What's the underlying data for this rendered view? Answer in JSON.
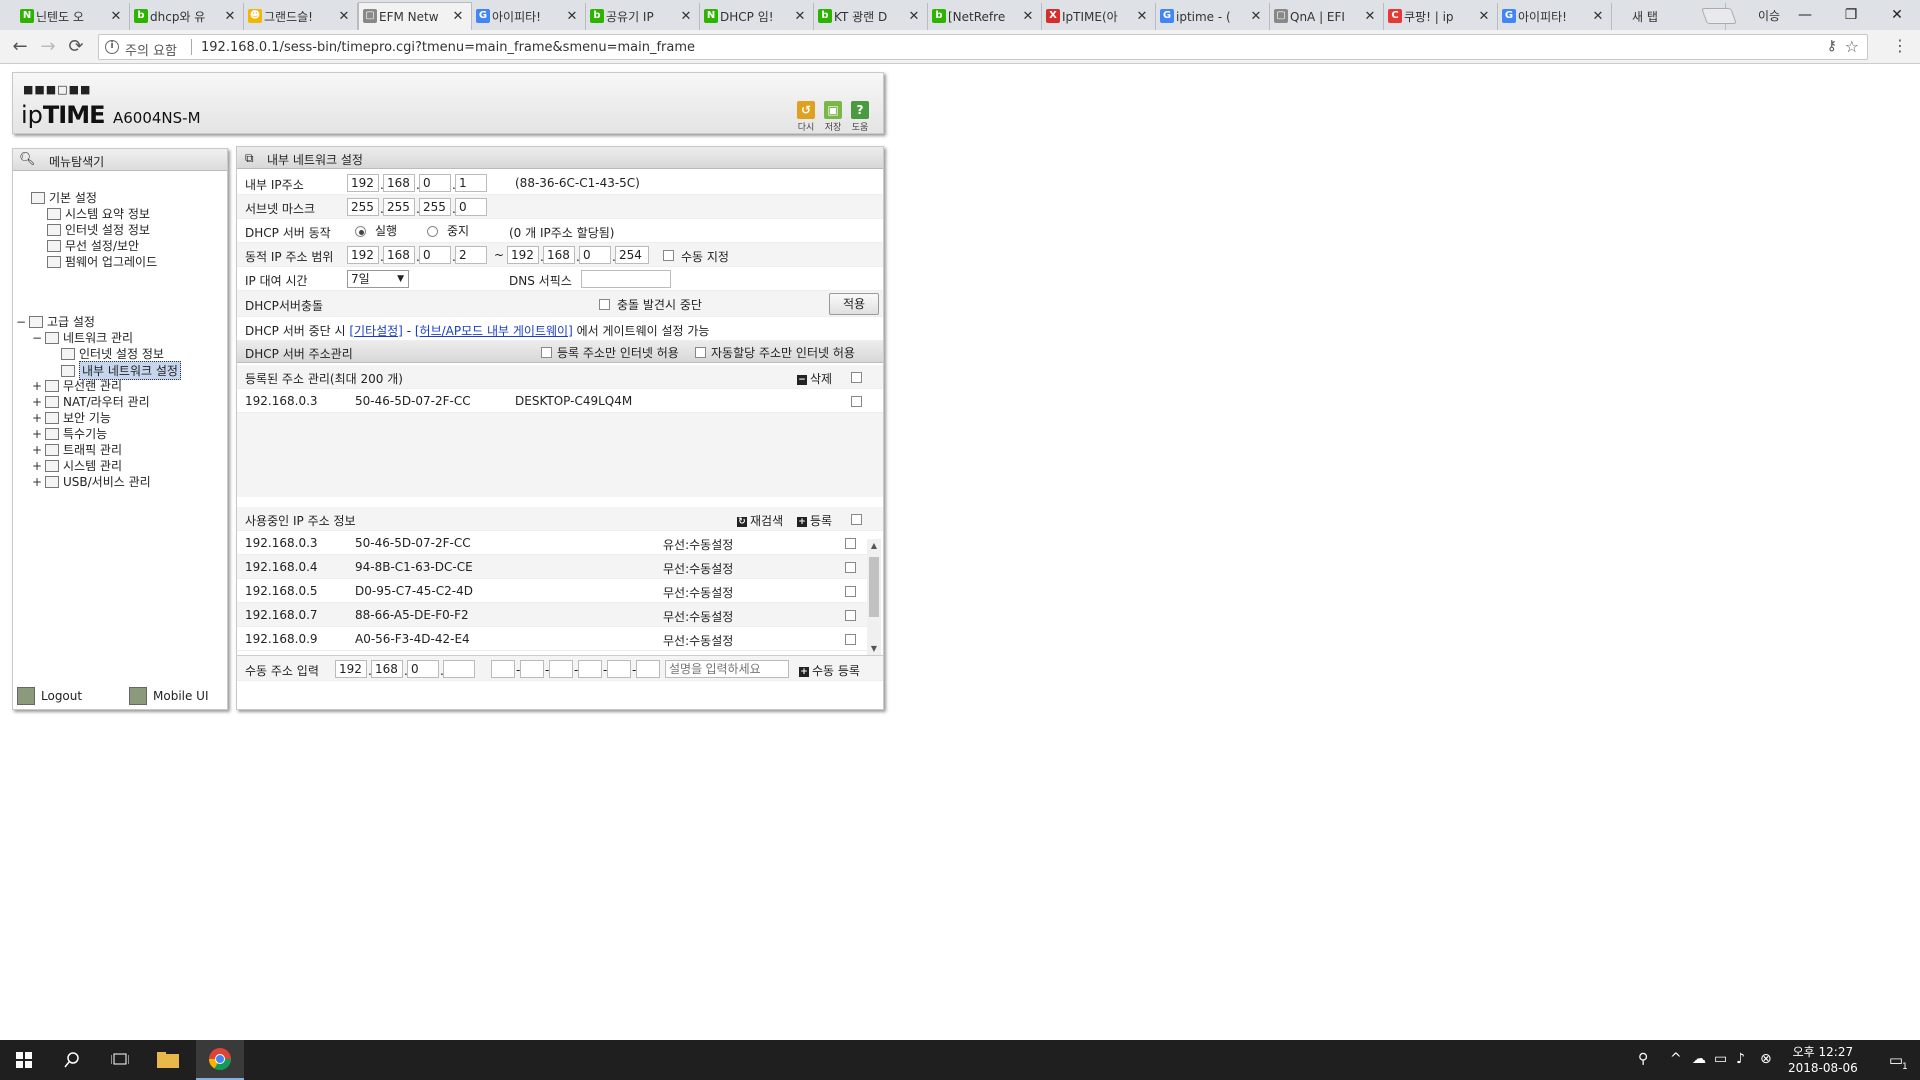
{
  "browser": {
    "tabs": [
      {
        "label": "닌텐도 오",
        "favicon": "N",
        "color": "#2db400"
      },
      {
        "label": "dhcp와 유",
        "favicon": "b",
        "color": "#2db400"
      },
      {
        "label": "그랜드슬!",
        "favicon": "☻",
        "color": "#f2b705"
      },
      {
        "label": "EFM Netw",
        "favicon": "▢",
        "color": "#888888"
      },
      {
        "label": "아이피타!",
        "favicon": "G",
        "color": "#4285f4"
      },
      {
        "label": "공유기 IP",
        "favicon": "b",
        "color": "#2db400"
      },
      {
        "label": "DHCP 임!",
        "favicon": "N",
        "color": "#2db400"
      },
      {
        "label": "KT 광랜 D",
        "favicon": "b",
        "color": "#2db400"
      },
      {
        "label": "[NetRefre",
        "favicon": "b",
        "color": "#2db400"
      },
      {
        "label": "IpTIME(아",
        "favicon": "X",
        "color": "#d32f2f"
      },
      {
        "label": "iptime - (",
        "favicon": "G",
        "color": "#4285f4"
      },
      {
        "label": "QnA | EFI",
        "favicon": "▢",
        "color": "#888888"
      },
      {
        "label": "쿠팡! | ip",
        "favicon": "C",
        "color": "#e53935"
      },
      {
        "label": "아이피타!",
        "favicon": "G",
        "color": "#4285f4"
      },
      {
        "label": "새 탭",
        "favicon": "",
        "color": "#dee1e6"
      }
    ],
    "active_tab_index": 3,
    "profile_label": "이승",
    "window_buttons": [
      "—",
      "❐",
      "✕"
    ],
    "nav": {
      "back": "←",
      "forward": "→",
      "reload": "⟳"
    },
    "address": {
      "security_label": "주의 요함",
      "url": "192.168.0.1/sess-bin/timepro.cgi?tmenu=main_frame&smenu=main_frame"
    }
  },
  "router": {
    "logo_dots": "■■■□■■",
    "logo_ip": "ip",
    "logo_time": "TIME",
    "model": "A6004NS-M",
    "header_buttons": [
      {
        "label": "다시",
        "icon": "refresh-icon",
        "color": "#e0a020",
        "glyph": "↺"
      },
      {
        "label": "저장",
        "icon": "save-icon",
        "color": "#7ab648",
        "glyph": "▣"
      },
      {
        "label": "도움",
        "icon": "help-icon",
        "color": "#4a9a40",
        "glyph": "?"
      }
    ],
    "left": {
      "title": "메뉴탐색기",
      "basic": {
        "label": "기본 설정",
        "items": [
          "시스템 요약 정보",
          "인터넷 설정 정보",
          "무선 설정/보안",
          "펌웨어 업그레이드"
        ]
      },
      "advanced": {
        "label": "고급 설정",
        "network": {
          "label": "네트워크 관리",
          "items": [
            "인터넷 설정 정보",
            "내부 네트워크 설정"
          ]
        },
        "others": [
          "무선랜 관리",
          "NAT/라우터 관리",
          "보안 기능",
          "특수기능",
          "트래픽 관리",
          "시스템 관리",
          "USB/서비스 관리"
        ]
      },
      "logout": "Logout",
      "mobile": "Mobile UI"
    },
    "main": {
      "title": "내부 네트워크 설정",
      "internal_ip": {
        "label": "내부 IP주소",
        "octets": [
          "192",
          "168",
          "0",
          "1"
        ],
        "mac": "(88-36-6C-C1-43-5C)"
      },
      "subnet": {
        "label": "서브넷 마스크",
        "octets": [
          "255",
          "255",
          "255",
          "0"
        ]
      },
      "dhcp": {
        "label": "DHCP 서버 동작",
        "on_label": "실행",
        "off_label": "중지",
        "status": "(0 개 IP주소 할당됨)"
      },
      "range": {
        "label": "동적 IP 주소 범위",
        "start": [
          "192",
          "168",
          "0",
          "2"
        ],
        "sep": "~",
        "end": [
          "192",
          "168",
          "0",
          "254"
        ],
        "manual_label": "수동 지정"
      },
      "lease": {
        "label": "IP 대여 시간",
        "value": "7일",
        "dns_label": "DNS 서픽스",
        "dns_value": ""
      },
      "conflict": {
        "label": "DHCP서버충돌",
        "check_label": "충돌 발견시 중단",
        "apply": "적용"
      },
      "notice": {
        "prefix": "DHCP 서버 중단 시 ",
        "link1": "[기타설정]",
        "middle": " - ",
        "link2": "[허브/AP모드 내부 게이트웨이]",
        "suffix": " 에서 게이트웨이 설정 가능"
      },
      "addr_mgmt": {
        "title": "DHCP 서버 주소관리",
        "opt1": "등록 주소만 인터넷 허용",
        "opt2": "자동할당 주소만 인터넷 허용"
      },
      "registered": {
        "title": "등록된 주소 관리(최대 200 개)",
        "delete": "삭제",
        "rows": [
          {
            "ip": "192.168.0.3",
            "mac": "50-46-5D-07-2F-CC",
            "name": "DESKTOP-C49LQ4M"
          }
        ]
      },
      "in_use": {
        "title": "사용중인 IP 주소 정보",
        "rescan": "재검색",
        "register": "등록",
        "rows": [
          {
            "ip": "192.168.0.3",
            "mac": "50-46-5D-07-2F-CC",
            "type": "유선:수동설정"
          },
          {
            "ip": "192.168.0.4",
            "mac": "94-8B-C1-63-DC-CE",
            "type": "무선:수동설정"
          },
          {
            "ip": "192.168.0.5",
            "mac": "D0-95-C7-45-C2-4D",
            "type": "무선:수동설정"
          },
          {
            "ip": "192.168.0.7",
            "mac": "88-66-A5-DE-F0-F2",
            "type": "무선:수동설정"
          },
          {
            "ip": "192.168.0.9",
            "mac": "A0-56-F3-4D-42-E4",
            "type": "무선:수동설정"
          }
        ]
      },
      "manual": {
        "label": "수동 주소 입력",
        "octets": [
          "192",
          "168",
          "0",
          ""
        ],
        "desc_placeholder": "설명을 입력하세요",
        "button": "수동 등록"
      }
    }
  },
  "taskbar": {
    "clock_time": "오후 12:27",
    "clock_date": "2018-08-06",
    "notification_count": "1"
  }
}
